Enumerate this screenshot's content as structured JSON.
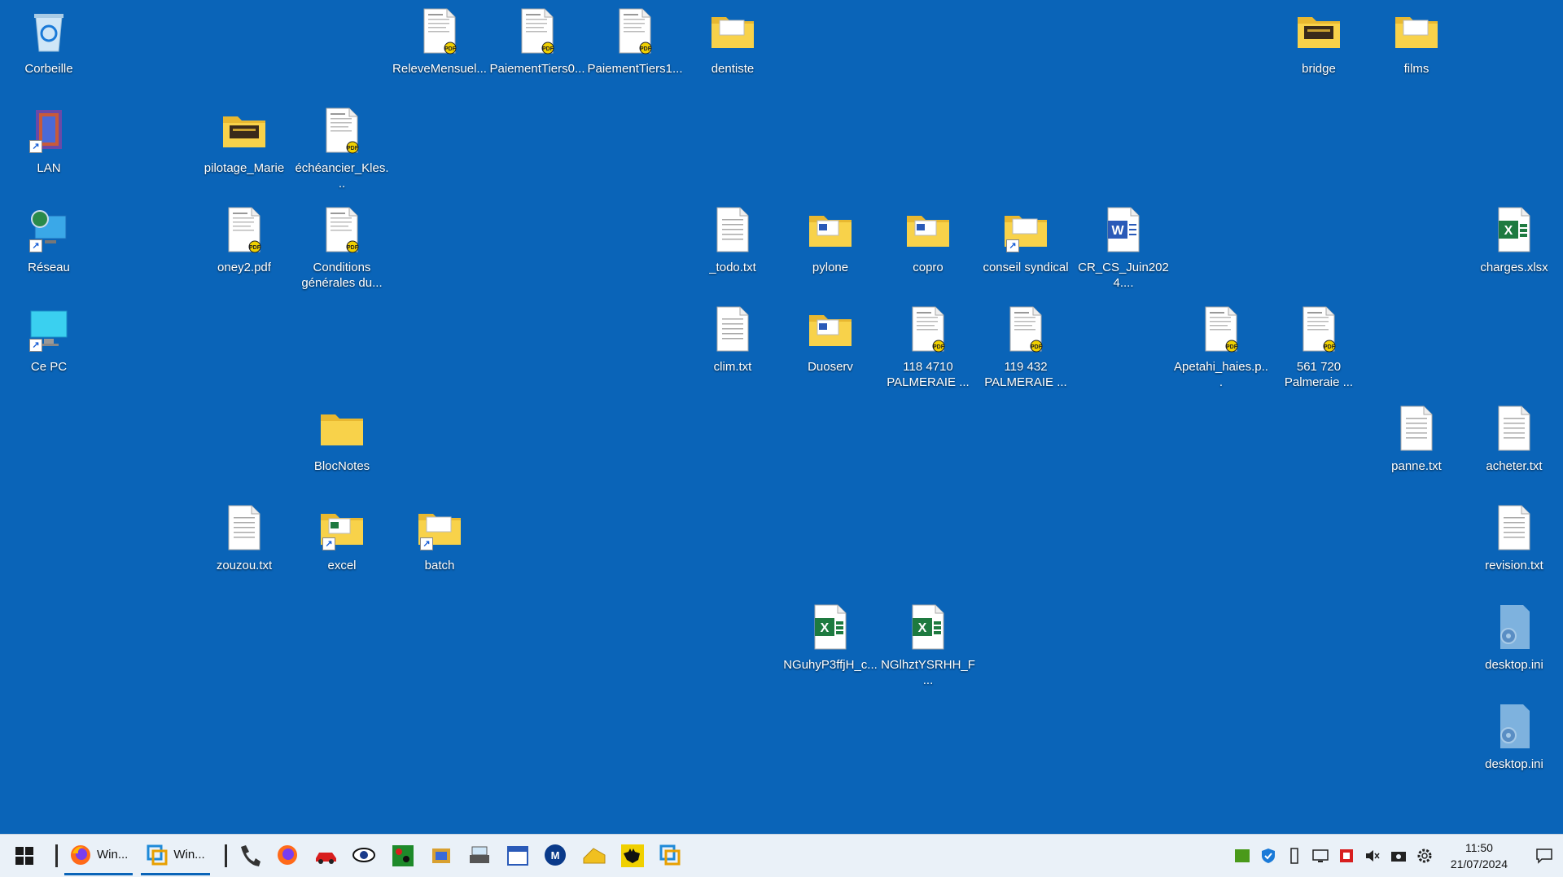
{
  "desktop_icons": [
    {
      "label": "Corbeille",
      "type": "recycle",
      "col": 0,
      "row": 0
    },
    {
      "label": "LAN",
      "type": "book",
      "col": 0,
      "row": 1,
      "shortcut": true
    },
    {
      "label": "Réseau",
      "type": "network",
      "col": 0,
      "row": 2,
      "shortcut": true
    },
    {
      "label": "Ce PC",
      "type": "pc",
      "col": 0,
      "row": 3,
      "shortcut": true
    },
    {
      "label": "pilotage_Marie",
      "type": "folder-dark",
      "col": 2,
      "row": 1
    },
    {
      "label": "échéancier_Kles...",
      "type": "pdf",
      "col": 3,
      "row": 1
    },
    {
      "label": "oney2.pdf",
      "type": "pdf",
      "col": 2,
      "row": 2
    },
    {
      "label": "Conditions générales du...",
      "type": "pdf",
      "col": 3,
      "row": 2
    },
    {
      "label": "BlocNotes",
      "type": "folder",
      "col": 3,
      "row": 4
    },
    {
      "label": "zouzou.txt",
      "type": "txt",
      "col": 2,
      "row": 5
    },
    {
      "label": "excel",
      "type": "folder-excel",
      "col": 3,
      "row": 5,
      "shortcut": true
    },
    {
      "label": "batch",
      "type": "folder-doc",
      "col": 4,
      "row": 5,
      "shortcut": true
    },
    {
      "label": "ReleveMensuel...",
      "type": "pdf",
      "col": 4,
      "row": 0
    },
    {
      "label": "PaiementTiers0...",
      "type": "pdf",
      "col": 5,
      "row": 0
    },
    {
      "label": "PaiementTiers1...",
      "type": "pdf",
      "col": 6,
      "row": 0
    },
    {
      "label": "dentiste",
      "type": "folder-doc",
      "col": 7,
      "row": 0
    },
    {
      "label": "_todo.txt",
      "type": "txt",
      "col": 7,
      "row": 2
    },
    {
      "label": "clim.txt",
      "type": "txt",
      "col": 7,
      "row": 3
    },
    {
      "label": "pylone",
      "type": "folder-word",
      "col": 8,
      "row": 2
    },
    {
      "label": "Duoserv",
      "type": "folder-word",
      "col": 8,
      "row": 3
    },
    {
      "label": "copro",
      "type": "folder-word",
      "col": 9,
      "row": 2
    },
    {
      "label": "118 4710 PALMERAIE ...",
      "type": "pdf",
      "col": 9,
      "row": 3
    },
    {
      "label": "conseil syndical",
      "type": "folder-doc",
      "col": 10,
      "row": 2,
      "shortcut": true
    },
    {
      "label": "119 432 PALMERAIE ...",
      "type": "pdf",
      "col": 10,
      "row": 3
    },
    {
      "label": "CR_CS_Juin2024....",
      "type": "word",
      "col": 11,
      "row": 2
    },
    {
      "label": "Apetahi_haies.p...",
      "type": "pdf",
      "col": 12,
      "row": 3
    },
    {
      "label": "bridge",
      "type": "folder-dark",
      "col": 13,
      "row": 0
    },
    {
      "label": "561 720 Palmeraie ...",
      "type": "pdf",
      "col": 13,
      "row": 3
    },
    {
      "label": "films",
      "type": "folder-doc",
      "col": 14,
      "row": 0
    },
    {
      "label": "panne.txt",
      "type": "txt",
      "col": 14,
      "row": 4
    },
    {
      "label": "charges.xlsx",
      "type": "excel",
      "col": 15,
      "row": 2
    },
    {
      "label": "acheter.txt",
      "type": "txt",
      "col": 15,
      "row": 4
    },
    {
      "label": "revision.txt",
      "type": "txt",
      "col": 15,
      "row": 5
    },
    {
      "label": "desktop.ini",
      "type": "ini",
      "col": 15,
      "row": 6
    },
    {
      "label": "desktop.ini",
      "type": "ini",
      "col": 15,
      "row": 7
    },
    {
      "label": "NGuhyP3ffjH_c...",
      "type": "excel",
      "col": 8,
      "row": 6
    },
    {
      "label": "NGlhztYSRHH_F...",
      "type": "excel",
      "col": 9,
      "row": 6
    }
  ],
  "taskbar": {
    "open_apps": [
      {
        "label": "Win...",
        "icon": "firefox-icon"
      },
      {
        "label": "Win...",
        "icon": "vmware-icon"
      }
    ],
    "pinned": [
      "phone-icon",
      "firefox-icon",
      "car-icon",
      "eye-icon",
      "cards-icon",
      "box-icon",
      "scanner-icon",
      "calendar-icon",
      "malwarebytes-icon",
      "cheese-icon",
      "batman-icon",
      "vmware-icon"
    ],
    "tray": [
      "nvidia-icon",
      "shield-icon",
      "usb-icon",
      "display-icon",
      "red-app-icon",
      "mute-icon",
      "camera-icon",
      "gear-icon"
    ],
    "time": "11:50",
    "date": "21/07/2024"
  },
  "colors": {
    "desktop": "#0a64b8",
    "folder": "#f8d24a",
    "taskbar": "#eaf1f8"
  }
}
